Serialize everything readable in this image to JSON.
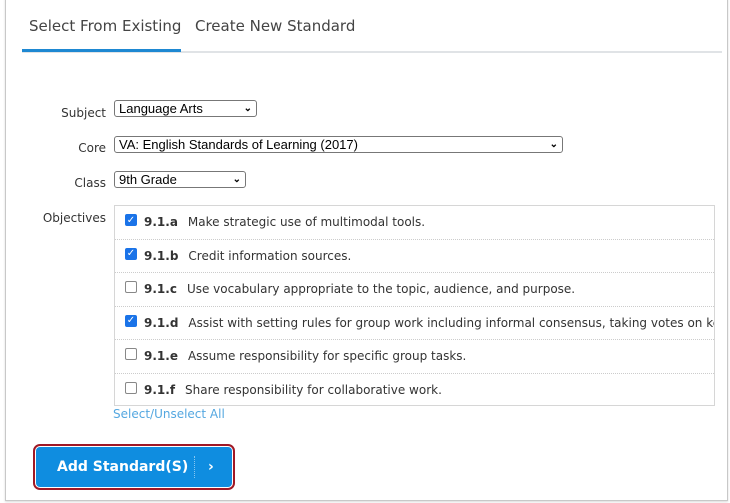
{
  "tabs": [
    {
      "label": "Select From Existing",
      "active": true
    },
    {
      "label": "Create New Standard",
      "active": false
    }
  ],
  "form": {
    "subject": {
      "label": "Subject",
      "value": "Language Arts"
    },
    "core": {
      "label": "Core",
      "value": "VA: English Standards of Learning (2017)"
    },
    "class": {
      "label": "Class",
      "value": "9th Grade"
    },
    "objectives_label": "Objectives",
    "objectives": [
      {
        "code": "9.1.a",
        "text": "Make strategic use of multimodal tools.",
        "checked": true
      },
      {
        "code": "9.1.b",
        "text": "Credit information sources.",
        "checked": true
      },
      {
        "code": "9.1.c",
        "text": "Use vocabulary appropriate to the topic, audience, and purpose.",
        "checked": false
      },
      {
        "code": "9.1.d",
        "text": "Assist with setting rules for group work including informal consensus, taking votes on key ...",
        "checked": true
      },
      {
        "code": "9.1.e",
        "text": "Assume responsibility for specific group tasks.",
        "checked": false
      },
      {
        "code": "9.1.f",
        "text": "Share responsibility for collaborative work.",
        "checked": false
      }
    ],
    "select_all": "Select/Unselect All"
  },
  "button": {
    "label": "Add Standard(S)",
    "chevron": "›"
  },
  "colors": {
    "accent": "#0f8de0",
    "highlight": "#a01825",
    "link": "#54a7e0"
  }
}
